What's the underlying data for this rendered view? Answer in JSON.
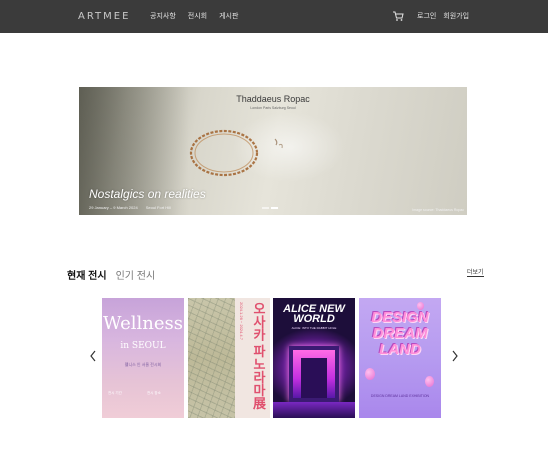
{
  "header": {
    "logo": "ARTMEE",
    "nav": [
      "공지사항",
      "전시회",
      "게시판"
    ],
    "cart_icon": "cart-icon",
    "login": "로그인",
    "signup": "회원가입"
  },
  "hero": {
    "gallery_name": "Thaddaeus Ropac",
    "gallery_cities": "London Paris Salzburg Seoul",
    "title": "Nostalgics on realities",
    "date_range": "29 January – 9 March 2024",
    "venue": "Seoul Fort Hill",
    "credit": "Image source: Thaddaeus Ropac",
    "slide_count": 2,
    "active_slide": 2
  },
  "exhibitions": {
    "tabs": [
      "현재 전시",
      "인기 전시"
    ],
    "active_tab": 0,
    "more_label": "더보기",
    "prev_icon": "chevron-left-icon",
    "next_icon": "chevron-right-icon",
    "posters": [
      {
        "title": "Wellness",
        "subtitle": "in SEOUL",
        "info": "웰니스 인 서울 전시회",
        "left_note": "전시 기간",
        "right_note": "전시 장소"
      },
      {
        "title": "오사카 파노라마展",
        "date": "2024.1.26 ~ 2024.4.7"
      },
      {
        "title": "ALICE NEW WORLD",
        "subtitle": "ALICE: INTO THE RABBIT HOLE"
      },
      {
        "title": "DESIGN DREAM LAND",
        "subtitle": "DESIGN DREAM LAND EXHIBITION"
      }
    ]
  }
}
